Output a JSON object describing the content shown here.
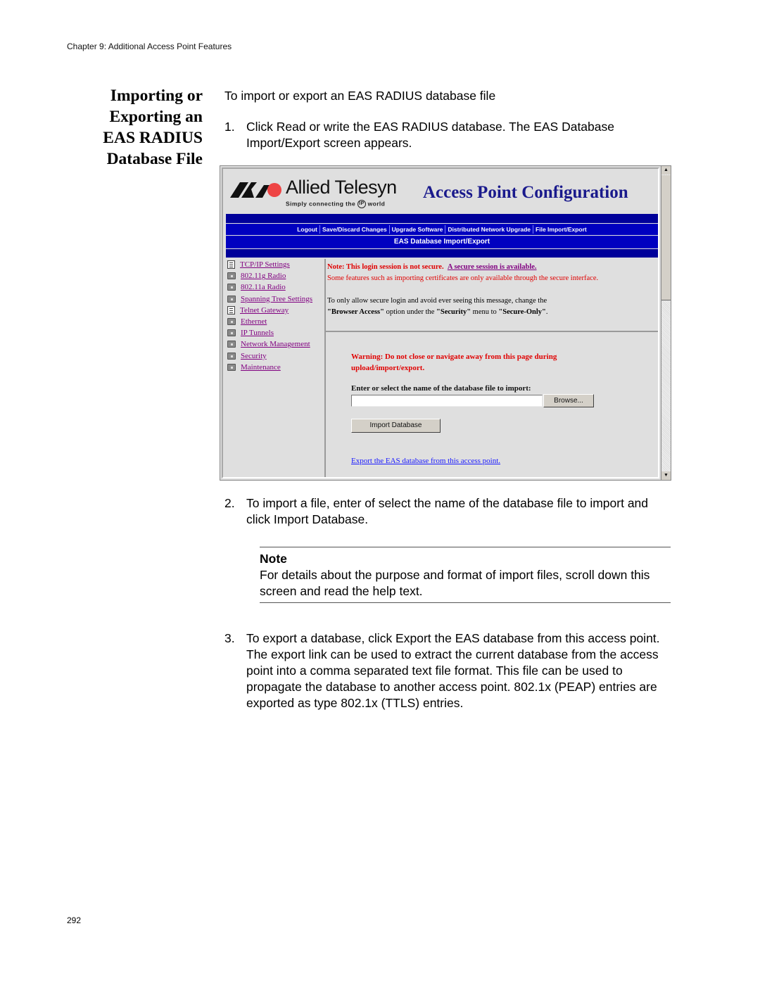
{
  "running_header": "Chapter 9: Additional Access Point Features",
  "section_heading": [
    "Importing or",
    "Exporting an",
    "EAS RADIUS",
    "Database File"
  ],
  "intro": "To import or export an EAS RADIUS database file",
  "steps": [
    {
      "num": "1.",
      "text": "Click Read or write the EAS RADIUS database. The EAS Database Import/Export screen appears."
    },
    {
      "num": "2.",
      "text": "To import a file, enter of select the name of the database file to import and click Import Database."
    },
    {
      "num": "3.",
      "text": "To export a database, click Export the EAS database from this access point. The export link can be used to extract the current database from the access point into a comma separated text file format. This file can be used to propagate the database to another access point. 802.1x (PEAP) entries are exported as type 802.1x (TTLS) entries."
    }
  ],
  "note": {
    "title": "Note",
    "text": "For details about the purpose and format of import files, scroll down this screen and read the help text."
  },
  "page_number": "292",
  "screenshot": {
    "logo_name": "Allied Telesyn",
    "logo_tagline_pre": "Simply connecting the",
    "logo_tagline_ip": "IP",
    "logo_tagline_post": "world",
    "app_title": "Access Point Configuration",
    "nav": [
      "Logout",
      "Save/Discard Changes",
      "Upgrade Software",
      "Distributed Network Upgrade",
      "File Import/Export"
    ],
    "page_title": "EAS Database Import/Export",
    "sidebar": [
      {
        "label": "TCP/IP Settings",
        "icon": "page-icon"
      },
      {
        "label": "802.11g Radio",
        "icon": "folder-icon"
      },
      {
        "label": "802.11a Radio",
        "icon": "folder-icon"
      },
      {
        "label": "Spanning Tree Settings",
        "icon": "folder-icon"
      },
      {
        "label": "Telnet Gateway",
        "icon": "page-icon"
      },
      {
        "label": "Ethernet",
        "icon": "folder-icon"
      },
      {
        "label": "IP Tunnels",
        "icon": "folder-icon"
      },
      {
        "label": "Network Management",
        "icon": "folder-icon"
      },
      {
        "label": "Security",
        "icon": "folder-icon"
      },
      {
        "label": "Maintenance",
        "icon": "folder-icon"
      }
    ],
    "security_note": "Note: This login session is not secure.",
    "secure_link": "A secure session is available.",
    "features_note": "Some features such as importing certificates are only available through the secure interface.",
    "secure_only_pre": "To only allow secure login and avoid ever seeing this message, change the",
    "browser_access": "\"Browser Access\"",
    "option_under": " option under the ",
    "security_menu": "\"Security\"",
    "menu_to": " menu to ",
    "secure_only": "\"Secure-Only\"",
    "period": ".",
    "warning_line1": "Warning: Do not close or navigate away from this page during",
    "warning_line2": "upload/import/export.",
    "file_prompt": "Enter or select the name of the database file to import:",
    "file_value": "",
    "browse_label": "Browse...",
    "import_label": "Import Database",
    "export_link": "Export the EAS database from this access point.",
    "colors": {
      "nav_blue": "#0000c0",
      "title_blue": "#1a1a8c",
      "warning_red": "#e00000",
      "visited_link": "#800080",
      "link_blue": "#1a1aff"
    }
  }
}
